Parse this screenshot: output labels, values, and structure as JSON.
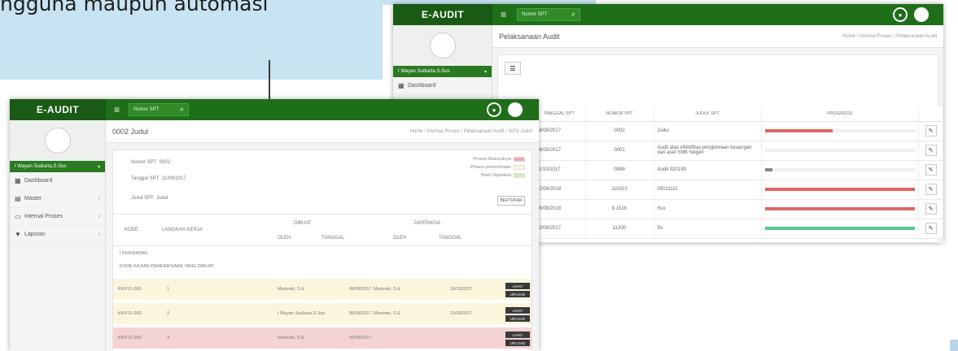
{
  "caption": {
    "text": "ngguna maupun automasi"
  },
  "app": {
    "brand": "E-AUDIT",
    "search_placeholder": "Nomor SPT",
    "user_name": "I Wayan Sudiarta,S.Sos",
    "colors": {
      "topbar": "#1f6e1a",
      "brand_bg": "#195a14",
      "progress_red": "#e06666",
      "progress_green": "#5cc48a"
    }
  },
  "sidebar": {
    "items": [
      {
        "label": "Dashboard",
        "icon": "dashboard-icon"
      },
      {
        "label": "Master",
        "icon": "database-icon"
      },
      {
        "label": "Internal Proses",
        "icon": "list-icon"
      },
      {
        "label": "Laporan",
        "icon": "report-icon"
      }
    ]
  },
  "right_window": {
    "page_title": "Pelaksanaan Audit",
    "breadcrumb": "Home / Internal Proses / Pelaksanaan Audit",
    "columns": [
      "TANGGAL SPT",
      "NOMOR SPT",
      "JUDUL SPT",
      "PROGRESS",
      ""
    ],
    "rows": [
      {
        "date": "18/08/2017",
        "number": "0002",
        "title": "Judul",
        "progress": 0.45,
        "color": "#e06666"
      },
      {
        "date": "06/09/2017",
        "number": "0001",
        "title": "Audit atas efektifitas pengelolaan keuangan dan aset SMK Negeri",
        "progress": 0.0,
        "color": "#e06666"
      },
      {
        "date": "11/10/2017",
        "number": "0999",
        "title": "Audit 020199",
        "progress": 0.05,
        "color": "#888888"
      },
      {
        "date": "12/04/2018",
        "number": "110022",
        "title": "00011111",
        "progress": 1.0,
        "color": "#e06666"
      },
      {
        "date": "16/08/2018",
        "number": "8.1516",
        "title": "Ssx",
        "progress": 1.0,
        "color": "#e06666"
      },
      {
        "date": "22/08/2017",
        "number": "11200",
        "title": "Ss",
        "progress": 1.0,
        "color": "#5cc48a"
      }
    ]
  },
  "left_window": {
    "page_title": "0002 Judul",
    "breadcrumb": "Home / Internal Proses / Pelaksanaan Audit / 0002 Judul",
    "fields": [
      {
        "label": "Nomor SPT",
        "value": "0002"
      },
      {
        "label": "Tanggal SPT",
        "value": "21/08/2017"
      },
      {
        "label": "Judul SPT",
        "value": "Judul"
      }
    ],
    "legend": [
      {
        "label": "Proses Maksudnya",
        "color": "#f3a9a9"
      },
      {
        "label": "Proses pemeriksaan",
        "color": "#fbf5dc"
      },
      {
        "label": "Telah Diperiksa",
        "color": "#d3edc5"
      }
    ],
    "status_button": "BERTUKAR",
    "header": {
      "kode": "KODE",
      "langkah": "LANGKAH KERJA",
      "dibuat": "DIBUAT",
      "diperiksa": "DIPERIKSA",
      "oleh": "OLEH",
      "tanggal": "TANGGAL"
    },
    "section_i": "I  PERSIAPAN",
    "section_sub": "KODE  KAJIAN PEMERIKSAAN YANG DIBUAT",
    "rows": [
      {
        "kode": "KKP.01.000",
        "step": "1",
        "dibuat_oleh": "Marwoto, S.E",
        "dibuat_tgl": "06/08/2017",
        "periksa_oleh": "Marwoto, S.E",
        "periksa_tgl": "18/10/2017",
        "bg": "#fbf5dc",
        "btn1": "LIHAT",
        "btn2": "UPLOAD"
      },
      {
        "kode": "KKP.01.000",
        "step": "2",
        "dibuat_oleh": "I Wayan Sudiarta,S.Sos",
        "dibuat_tgl": "06/08/2017",
        "periksa_oleh": "Marwoto, S.E",
        "periksa_tgl": "11/09/2017",
        "bg": "#fbf5dc",
        "btn1": "LIHAT",
        "btn2": "UPLOAD"
      },
      {
        "kode": "KKP.01.000",
        "step": "3",
        "dibuat_oleh": "Marwoto, S.E",
        "dibuat_tgl": "06/08/2017",
        "periksa_oleh": "",
        "periksa_tgl": "",
        "bg": "#f6d3d3",
        "btn1": "LIHAT",
        "btn2": "UPLOAD"
      }
    ]
  }
}
